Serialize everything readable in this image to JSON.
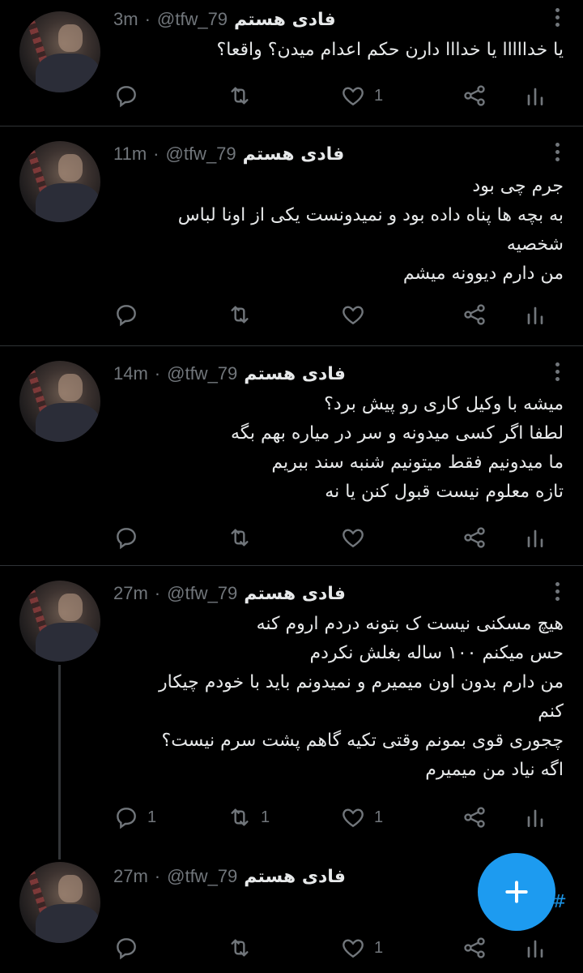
{
  "tweets": [
    {
      "name": "فادی هستم",
      "handle": "@tfw_79",
      "time": "3m",
      "lines": [
        "یا خدااااا یا خدااا دارن حکم اعدام میدن؟ واقعا؟"
      ],
      "replies": "",
      "retweets": "",
      "likes": "1"
    },
    {
      "name": "فادی هستم",
      "handle": "@tfw_79",
      "time": "11m",
      "lines": [
        "جرم چی بود",
        "به بچه ها پناه داده بود و نمیدونست یکی از اونا لباس",
        "شخصیه",
        "من دارم دیوونه میشم"
      ],
      "replies": "",
      "retweets": "",
      "likes": ""
    },
    {
      "name": "فادی هستم",
      "handle": "@tfw_79",
      "time": "14m",
      "lines": [
        "میشه با وکیل کاری رو پیش برد؟",
        "لطفا اگر کسی میدونه و سر در میاره بهم بگه",
        "ما میدونیم فقط میتونیم شنبه سند ببریم",
        "تازه معلوم نیست قبول کنن یا نه"
      ],
      "replies": "",
      "retweets": "",
      "likes": ""
    },
    {
      "name": "فادی هستم",
      "handle": "@tfw_79",
      "time": "27m",
      "lines": [
        "هیچ مسکنی نیست ک بتونه دردم اروم کنه",
        "حس میکنم ۱۰۰ ساله بغلش نکردم",
        "من دارم بدون اون میمیرم و نمیدونم باید با خودم چیکار",
        "کنم",
        "چجوری قوی بمونم وقتی تکیه گاهم پشت سرم نیست؟",
        "اگه نیاد من میمیرم"
      ],
      "replies": "1",
      "retweets": "1",
      "likes": "1"
    },
    {
      "name": "فادی هستم",
      "handle": "@tfw_79",
      "time": "27m",
      "lines": [],
      "replies": "",
      "retweets": "",
      "likes": "1"
    }
  ],
  "separator": "·",
  "hashtag_fragment": "#بی",
  "colors": {
    "background": "#000000",
    "text": "#e7e9ea",
    "muted": "#71767b",
    "accent": "#1d9bf0"
  },
  "icons": [
    "reply-icon",
    "retweet-icon",
    "like-icon",
    "share-icon",
    "analytics-icon",
    "more-icon",
    "compose-plus-icon"
  ]
}
